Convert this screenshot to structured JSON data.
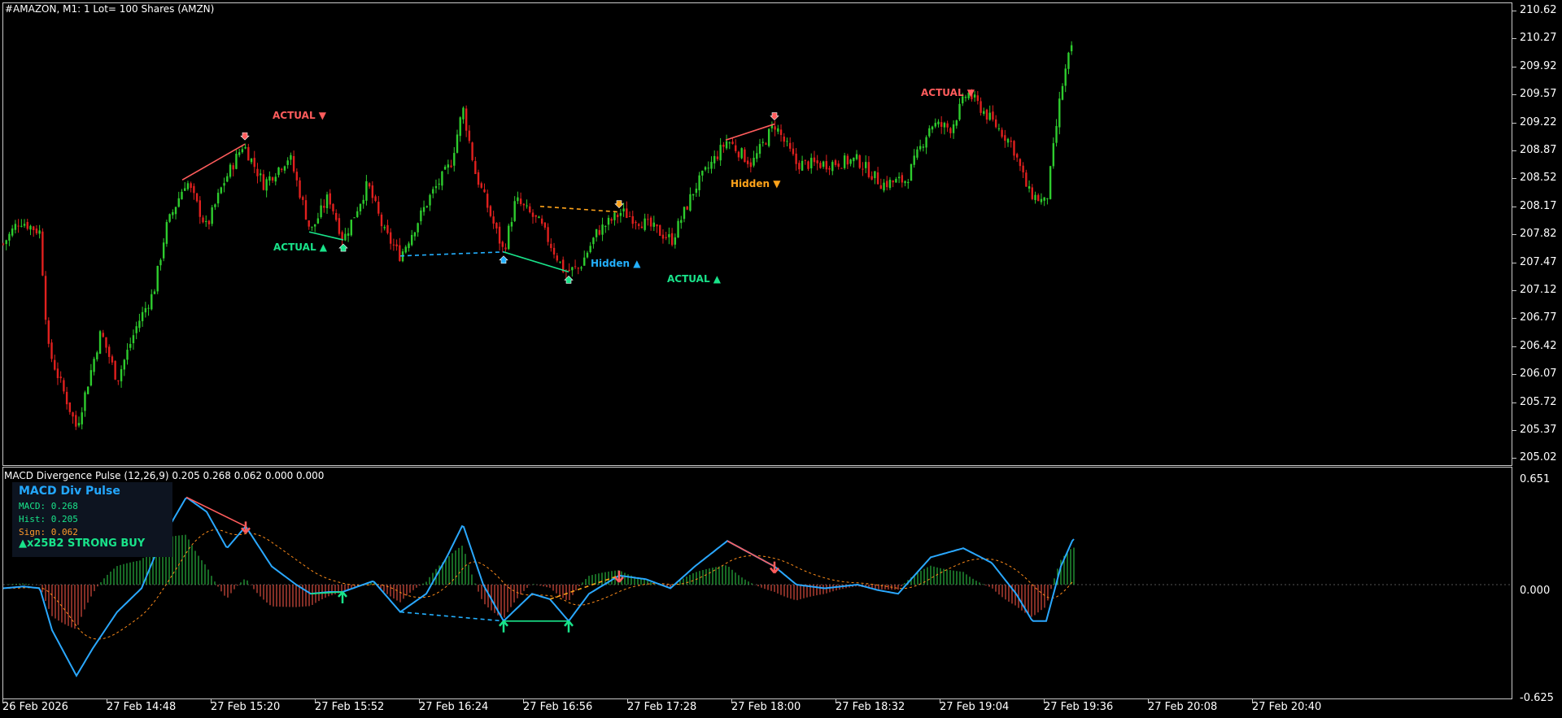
{
  "header": {
    "symbol": "#AMAZON, M1:  1 Lot= 100 Shares (AMZN)",
    "macd_title": "MACD Divergence Pulse (12,26,9) 0.205 0.268 0.062 0.000 0.000"
  },
  "colors": {
    "bull_candle": "#2ecc2e",
    "bear_candle": "#e0201e",
    "macd_line": "#2aa8ff",
    "signal_line": "#ff8c1a",
    "hist_pos": "#2fd04a",
    "hist_neg": "#ff5a4a",
    "actual_bear": "#ff5c5c",
    "actual_bull": "#19e38a",
    "hidden_bull": "#23b0ff",
    "hidden_bear": "#ffa31a"
  },
  "price_axis": [
    "210.62",
    "210.27",
    "209.92",
    "209.57",
    "209.22",
    "208.87",
    "208.52",
    "208.17",
    "207.82",
    "207.47",
    "207.12",
    "206.77",
    "206.42",
    "206.07",
    "205.72",
    "205.37",
    "205.02"
  ],
  "macd_axis": [
    "0.651",
    "0.000",
    "-0.625"
  ],
  "time_axis": [
    "26 Feb 2026",
    "27 Feb 14:48",
    "27 Feb 15:20",
    "27 Feb 15:52",
    "27 Feb 16:24",
    "27 Feb 16:56",
    "27 Feb 17:28",
    "27 Feb 18:00",
    "27 Feb 18:32",
    "27 Feb 19:04",
    "27 Feb 19:36",
    "27 Feb 20:08",
    "27 Feb 20:40"
  ],
  "info_panel": {
    "title": "MACD Div Pulse",
    "macd": "MACD: 0.268",
    "hist": "Hist: 0.205",
    "sign": "Sign: 0.062",
    "status": "▲x25B2 STRONG BUY",
    "macd_color": "#19e38a",
    "hist_color": "#19e38a",
    "sign_color": "#ff9a2a"
  },
  "labels": [
    {
      "text": "ACTUAL ▼",
      "kind": "actual_bear"
    },
    {
      "text": "ACTUAL ▲",
      "kind": "actual_bull"
    },
    {
      "text": "Hidden ▲",
      "kind": "hidden_bull"
    },
    {
      "text": "ACTUAL ▲",
      "kind": "actual_bull"
    },
    {
      "text": "Hidden ▼",
      "kind": "hidden_bear"
    },
    {
      "text": "ACTUAL ▼",
      "kind": "actual_bear"
    }
  ],
  "chart_data": {
    "type": "candlestick",
    "price_key_points": [
      [
        0,
        207.7
      ],
      [
        20,
        208.0
      ],
      [
        45,
        207.85
      ],
      [
        55,
        206.4
      ],
      [
        90,
        205.4
      ],
      [
        120,
        206.6
      ],
      [
        140,
        206.0
      ],
      [
        165,
        206.7
      ],
      [
        185,
        207.1
      ],
      [
        200,
        207.9
      ],
      [
        225,
        208.5
      ],
      [
        250,
        207.9
      ],
      [
        270,
        208.45
      ],
      [
        295,
        208.95
      ],
      [
        320,
        208.45
      ],
      [
        352,
        208.8
      ],
      [
        378,
        207.85
      ],
      [
        400,
        208.3
      ],
      [
        418,
        207.75
      ],
      [
        448,
        208.45
      ],
      [
        468,
        207.85
      ],
      [
        488,
        207.55
      ],
      [
        525,
        208.3
      ],
      [
        550,
        208.7
      ],
      [
        565,
        209.4
      ],
      [
        580,
        208.6
      ],
      [
        615,
        207.6
      ],
      [
        630,
        208.25
      ],
      [
        660,
        207.95
      ],
      [
        690,
        207.35
      ],
      [
        708,
        207.4
      ],
      [
        730,
        207.85
      ],
      [
        760,
        208.1
      ],
      [
        790,
        207.95
      ],
      [
        822,
        207.75
      ],
      [
        850,
        208.4
      ],
      [
        890,
        209.0
      ],
      [
        920,
        208.7
      ],
      [
        948,
        209.2
      ],
      [
        975,
        208.7
      ],
      [
        1010,
        208.7
      ],
      [
        1050,
        208.75
      ],
      [
        1080,
        208.45
      ],
      [
        1110,
        208.5
      ],
      [
        1140,
        209.2
      ],
      [
        1165,
        209.15
      ],
      [
        1185,
        209.6
      ],
      [
        1210,
        209.3
      ],
      [
        1240,
        208.95
      ],
      [
        1260,
        208.35
      ],
      [
        1282,
        208.2
      ],
      [
        1300,
        209.6
      ],
      [
        1312,
        210.15
      ],
      [
        1316,
        210.05
      ]
    ],
    "macd_key_points": [
      [
        0,
        -0.02
      ],
      [
        25,
        -0.01
      ],
      [
        45,
        -0.02
      ],
      [
        60,
        -0.25
      ],
      [
        90,
        -0.5
      ],
      [
        110,
        -0.35
      ],
      [
        140,
        -0.15
      ],
      [
        170,
        -0.02
      ],
      [
        195,
        0.25
      ],
      [
        225,
        0.48
      ],
      [
        250,
        0.4
      ],
      [
        275,
        0.2
      ],
      [
        298,
        0.32
      ],
      [
        330,
        0.1
      ],
      [
        360,
        0.0
      ],
      [
        378,
        -0.05
      ],
      [
        400,
        -0.04
      ],
      [
        417,
        -0.04
      ],
      [
        455,
        0.02
      ],
      [
        488,
        -0.15
      ],
      [
        520,
        -0.05
      ],
      [
        545,
        0.15
      ],
      [
        565,
        0.33
      ],
      [
        590,
        0.0
      ],
      [
        615,
        -0.2
      ],
      [
        650,
        -0.05
      ],
      [
        672,
        -0.08
      ],
      [
        695,
        -0.2
      ],
      [
        720,
        -0.05
      ],
      [
        757,
        0.05
      ],
      [
        790,
        0.03
      ],
      [
        820,
        -0.02
      ],
      [
        850,
        0.1
      ],
      [
        890,
        0.24
      ],
      [
        948,
        0.1
      ],
      [
        975,
        0.0
      ],
      [
        1010,
        -0.02
      ],
      [
        1050,
        0.0
      ],
      [
        1075,
        -0.03
      ],
      [
        1100,
        -0.05
      ],
      [
        1140,
        0.15
      ],
      [
        1180,
        0.2
      ],
      [
        1215,
        0.12
      ],
      [
        1245,
        -0.05
      ],
      [
        1265,
        -0.2
      ],
      [
        1282,
        -0.2
      ],
      [
        1300,
        0.1
      ],
      [
        1315,
        0.25
      ]
    ],
    "macd_ylim": [
      -0.625,
      0.651
    ],
    "price_ylim": [
      205.02,
      210.62
    ]
  }
}
